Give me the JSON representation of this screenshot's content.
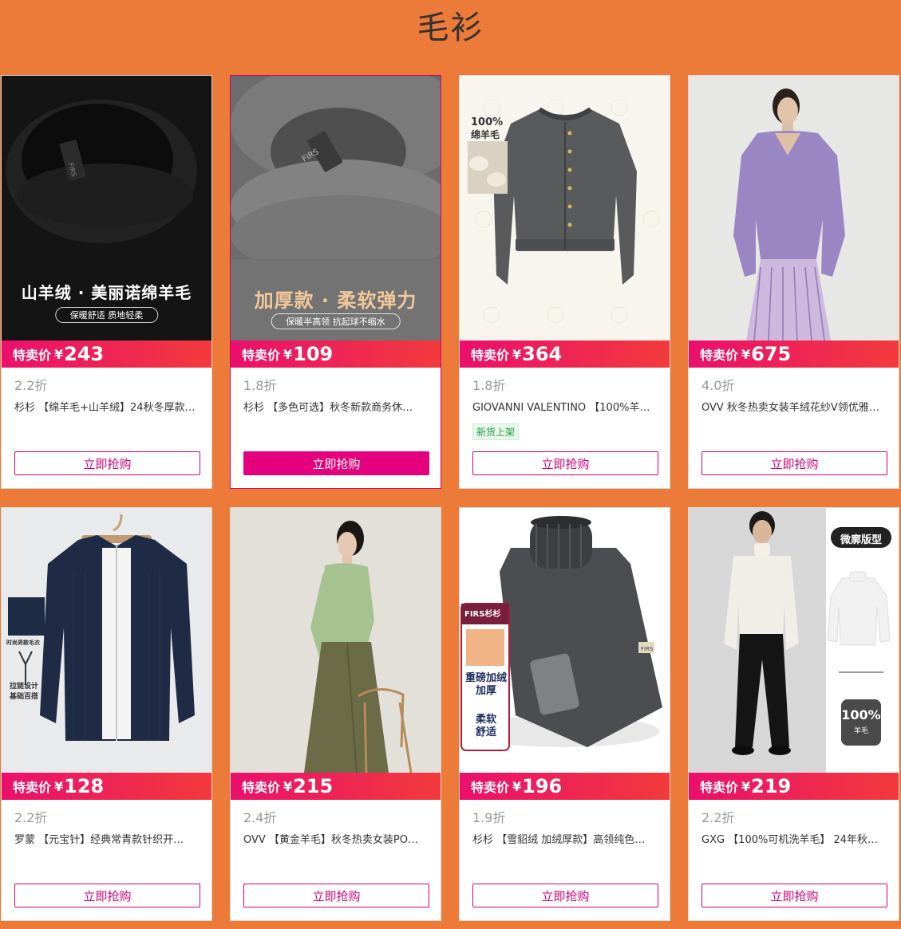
{
  "page": {
    "title": "毛衫"
  },
  "colors": {
    "background": "#ec7a38",
    "accent": "#e5007d",
    "price_gradient": [
      "#ea0f6d",
      "#f23a3c"
    ]
  },
  "products": [
    {
      "image": {
        "icon": "black-sweater-collar-photo",
        "caption": "山羊绒 · 美丽诺绵羊毛",
        "sub": "保暖舒适  质地轻柔"
      },
      "price_label": "特卖价",
      "currency": "¥",
      "price": "243",
      "discount": "2.2折",
      "title": "杉杉 【绵羊毛+山羊绒】24秋冬厚款…",
      "button": "立即抢购"
    },
    {
      "image": {
        "icon": "grey-sweater-collar-photo",
        "caption": "加厚款 · 柔软弹力",
        "sub": "保暖半高领 抗起球不缩水"
      },
      "price_label": "特卖价",
      "currency": "¥",
      "price": "109",
      "discount": "1.8折",
      "title": "杉杉 【多色可选】秋冬新款商务休…",
      "button": "立即抢购"
    },
    {
      "image": {
        "icon": "grey-cardigan-photo",
        "badge": "100%\n绵羊毛"
      },
      "price_label": "特卖价",
      "currency": "¥",
      "price": "364",
      "discount": "1.8折",
      "title": "GIOVANNI VALENTINO 【100%羊…",
      "tag": "新货上架",
      "button": "立即抢购"
    },
    {
      "image": {
        "icon": "purple-sweater-model-photo"
      },
      "price_label": "特卖价",
      "currency": "¥",
      "price": "675",
      "discount": "4.0折",
      "title": "OVV 秋冬热卖女装羊绒花纱V领优雅…",
      "button": "立即抢购"
    },
    {
      "image": {
        "icon": "navy-zip-cardigan-photo",
        "side_text": "时尚男款毛衣",
        "side_text2": "拉链设计\n基础百搭"
      },
      "price_label": "特卖价",
      "currency": "¥",
      "price": "128",
      "discount": "2.2折",
      "title": "罗蒙 【元宝针】经典常青款针织开…",
      "button": "立即抢购"
    },
    {
      "image": {
        "icon": "green-polo-sweater-model-photo"
      },
      "price_label": "特卖价",
      "currency": "¥",
      "price": "215",
      "discount": "2.4折",
      "title": "OVV 【黄金羊毛】秋冬热卖女装PO…",
      "button": "立即抢购"
    },
    {
      "image": {
        "icon": "dark-turtleneck-photo",
        "brand": "FIRS杉杉",
        "caption": "重磅加绒\n加厚",
        "caption2": "柔软\n舒适"
      },
      "price_label": "特卖价",
      "currency": "¥",
      "price": "196",
      "discount": "1.9折",
      "title": "杉杉 【雪貂绒 加绒厚款】高领纯色…",
      "button": "立即抢购"
    },
    {
      "image": {
        "icon": "white-turtleneck-model-photo",
        "badge": "微廓版型",
        "badge2": "100%",
        "badge2_sub": "羊毛"
      },
      "price_label": "特卖价",
      "currency": "¥",
      "price": "219",
      "discount": "2.2折",
      "title": "GXG 【100%可机洗羊毛】 24年秋…",
      "button": "立即抢购"
    }
  ]
}
